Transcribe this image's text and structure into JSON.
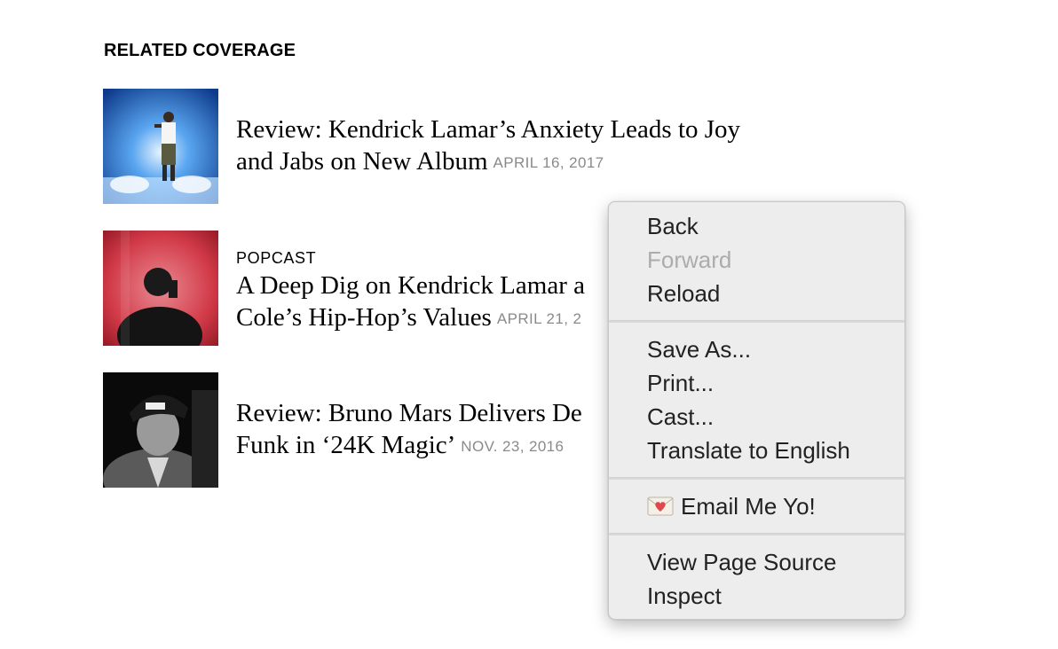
{
  "section": {
    "title": "RELATED COVERAGE"
  },
  "stories": [
    {
      "kicker": "",
      "headline": "Review: Kendrick Lamar’s Anxiety Leads to Joy and Jabs on New Album",
      "date": "APRIL 16, 2017",
      "thumb_icon": "concert-photo-blue"
    },
    {
      "kicker": "POPCAST",
      "headline": "A Deep Dig on Kendrick Lamar and J. Cole’s Hip-Hop’s Values",
      "headline_line1": "A Deep Dig on Kendrick Lamar a",
      "headline_line2": "Cole’s Hip-Hop’s Values",
      "date": "APRIL 21, 2",
      "thumb_icon": "concert-photo-red"
    },
    {
      "kicker": "",
      "headline_line1": "Review: Bruno Mars Delivers De",
      "headline_line2": "Funk in ‘24K Magic’",
      "date": "NOV. 23, 2016",
      "thumb_icon": "portrait-photo-bw"
    }
  ],
  "context_menu": {
    "group1": [
      {
        "label": "Back",
        "disabled": false
      },
      {
        "label": "Forward",
        "disabled": true
      },
      {
        "label": "Reload",
        "disabled": false
      }
    ],
    "group2": [
      {
        "label": "Save As..."
      },
      {
        "label": "Print..."
      },
      {
        "label": "Cast..."
      },
      {
        "label": "Translate to English"
      }
    ],
    "group3": [
      {
        "label": "Email Me Yo!",
        "icon": "love-letter-icon"
      }
    ],
    "group4": [
      {
        "label": "View Page Source"
      },
      {
        "label": "Inspect"
      }
    ]
  },
  "colors": {
    "menu_bg": "#ededed",
    "date_gray": "#8a8a8a",
    "disabled_text": "#acacac"
  }
}
